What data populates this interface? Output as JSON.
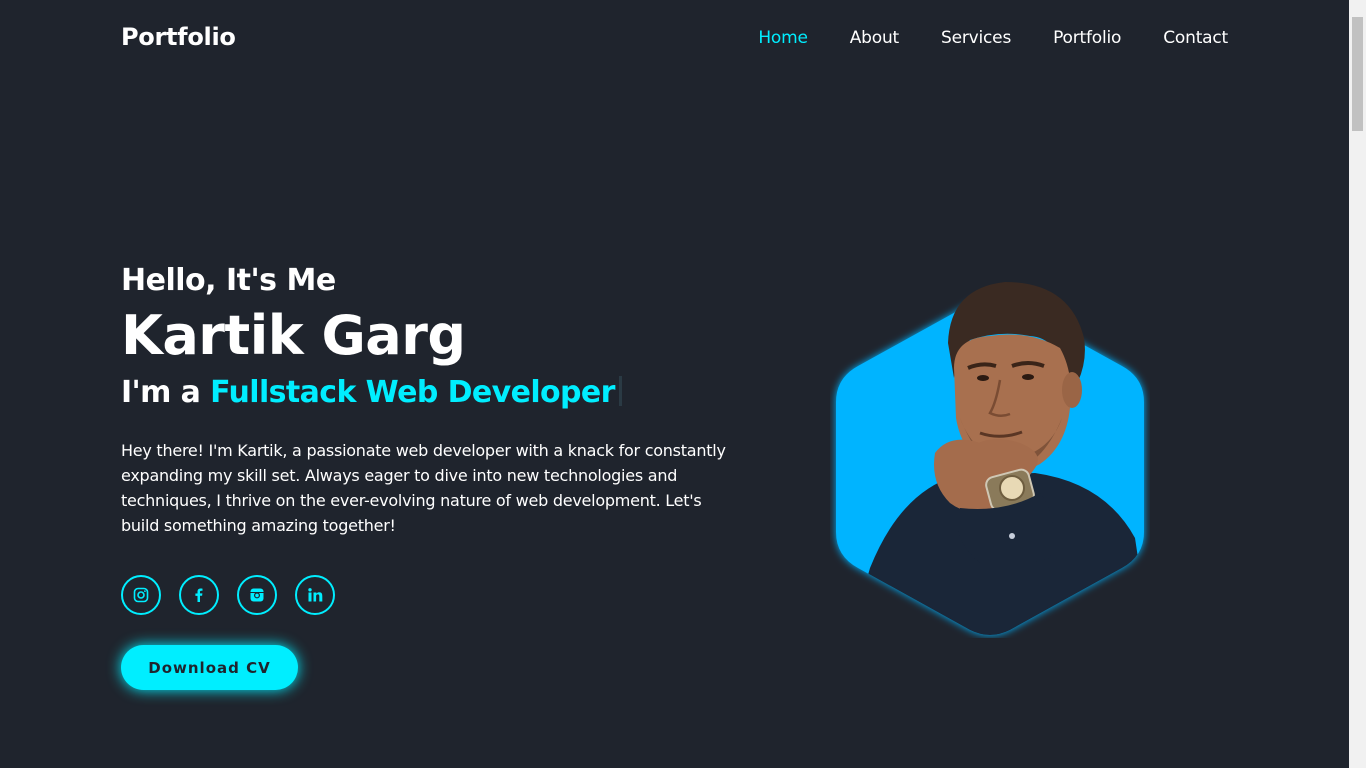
{
  "header": {
    "logo": "Portfolio",
    "nav": [
      {
        "label": "Home",
        "active": true
      },
      {
        "label": "About",
        "active": false
      },
      {
        "label": "Services",
        "active": false
      },
      {
        "label": "Portfolio",
        "active": false
      },
      {
        "label": "Contact",
        "active": false
      }
    ]
  },
  "home": {
    "greeting": "Hello, It's Me",
    "name": "Kartik Garg",
    "role_prefix": "I'm a ",
    "role_highlight": "Fullstack Web Developer",
    "description": "Hey there! I'm Kartik, a passionate web developer with a knack for constantly expanding my skill set. Always eager to dive into new technologies and techniques, I thrive on the ever-evolving nature of web development. Let's build something amazing together!",
    "social_icons": [
      "instagram-icon",
      "facebook-icon",
      "instagram-icon",
      "linkedin-icon"
    ],
    "cv_button": "Download CV"
  },
  "colors": {
    "background": "#1f242d",
    "accent": "#00eeff",
    "hexagon": "#00b4ff"
  }
}
